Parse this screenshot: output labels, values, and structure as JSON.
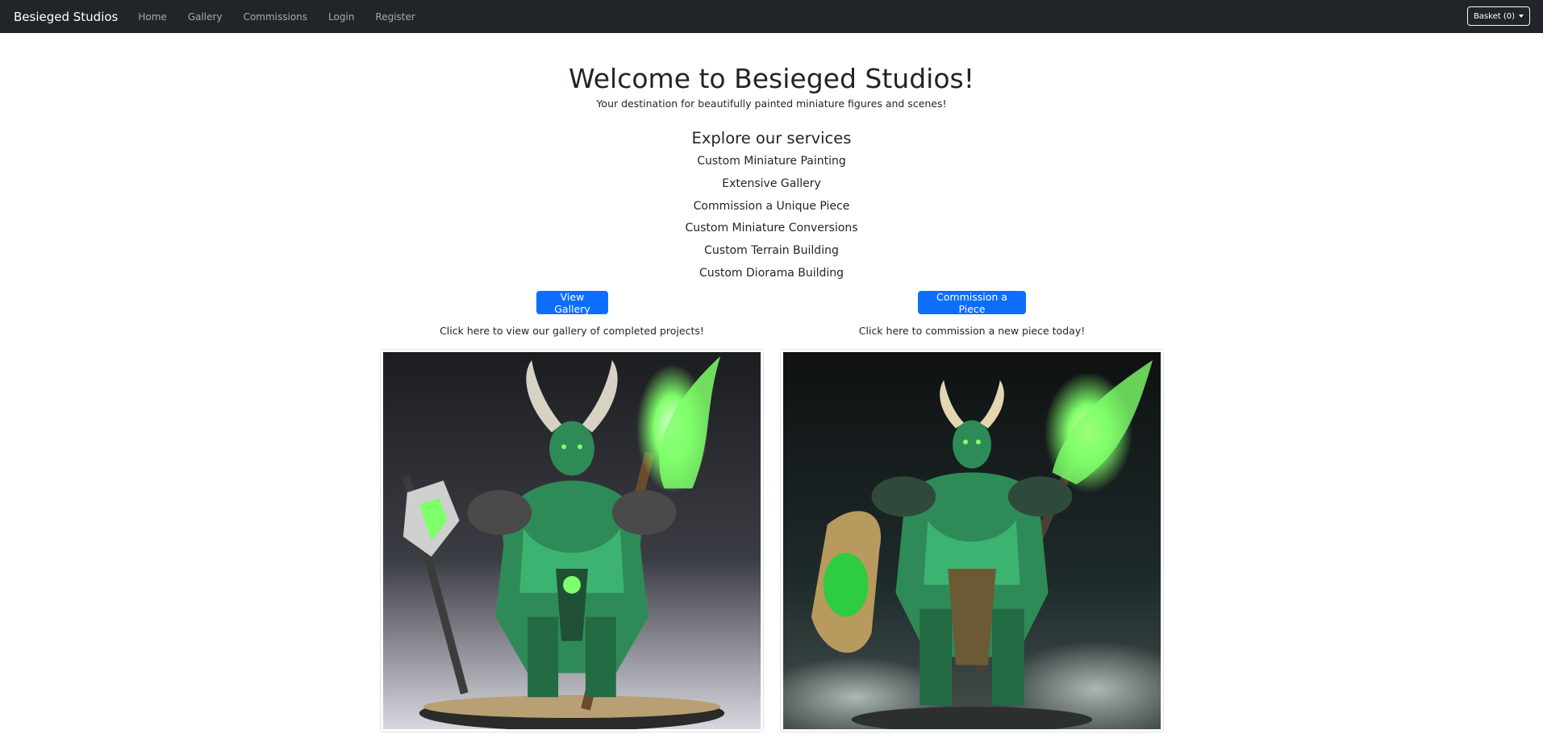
{
  "navbar": {
    "brand": "Besieged Studios",
    "links": [
      "Home",
      "Gallery",
      "Commissions",
      "Login",
      "Register"
    ],
    "basket_label": "Basket (0)"
  },
  "hero": {
    "title": "Welcome to Besieged Studios!",
    "subtitle": "Your destination for beautifully painted miniature figures and scenes!"
  },
  "services": {
    "heading": "Explore our services",
    "items": [
      "Custom Miniature Painting",
      "Extensive Gallery",
      "Commission a Unique Piece",
      "Custom Miniature Conversions",
      "Custom Terrain Building",
      "Custom Diorama Building"
    ]
  },
  "actions": {
    "gallery_button": "View Gallery",
    "gallery_caption": "Click here to view our gallery of completed projects!",
    "commission_button": "Commission a Piece",
    "commission_caption": "Click here to commission a new piece today!"
  },
  "colors": {
    "navbar_bg": "#212529",
    "primary": "#0d6efd",
    "figure_green": "#2e8b57",
    "glow_green": "#7fff6a"
  }
}
